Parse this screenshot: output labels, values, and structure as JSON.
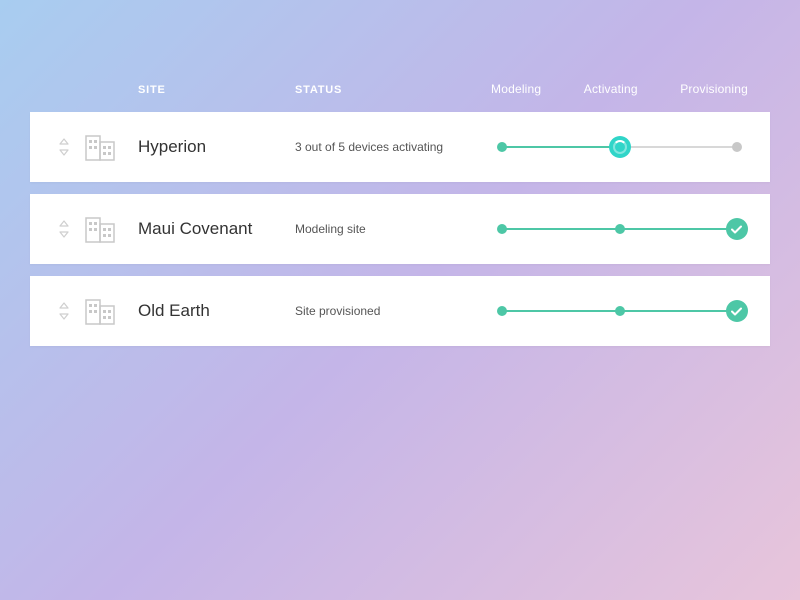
{
  "columns": {
    "site": "SITE",
    "status": "STATUS"
  },
  "phases": [
    "Modeling",
    "Activating",
    "Provisioning"
  ],
  "rows": [
    {
      "site": "Hyperion",
      "status": "3 out of 5 devices activating",
      "progress": {
        "current": 1,
        "state": "spinner"
      }
    },
    {
      "site": "Maui Covenant",
      "status": "Modeling site",
      "progress": {
        "current": 2,
        "state": "check"
      }
    },
    {
      "site": "Old Earth",
      "status": "Site provisioned",
      "progress": {
        "current": 2,
        "state": "check"
      }
    }
  ],
  "colors": {
    "accent": "#4dc7a6",
    "spinner": "#30d5c8",
    "inactive": "#c8c8c8"
  }
}
